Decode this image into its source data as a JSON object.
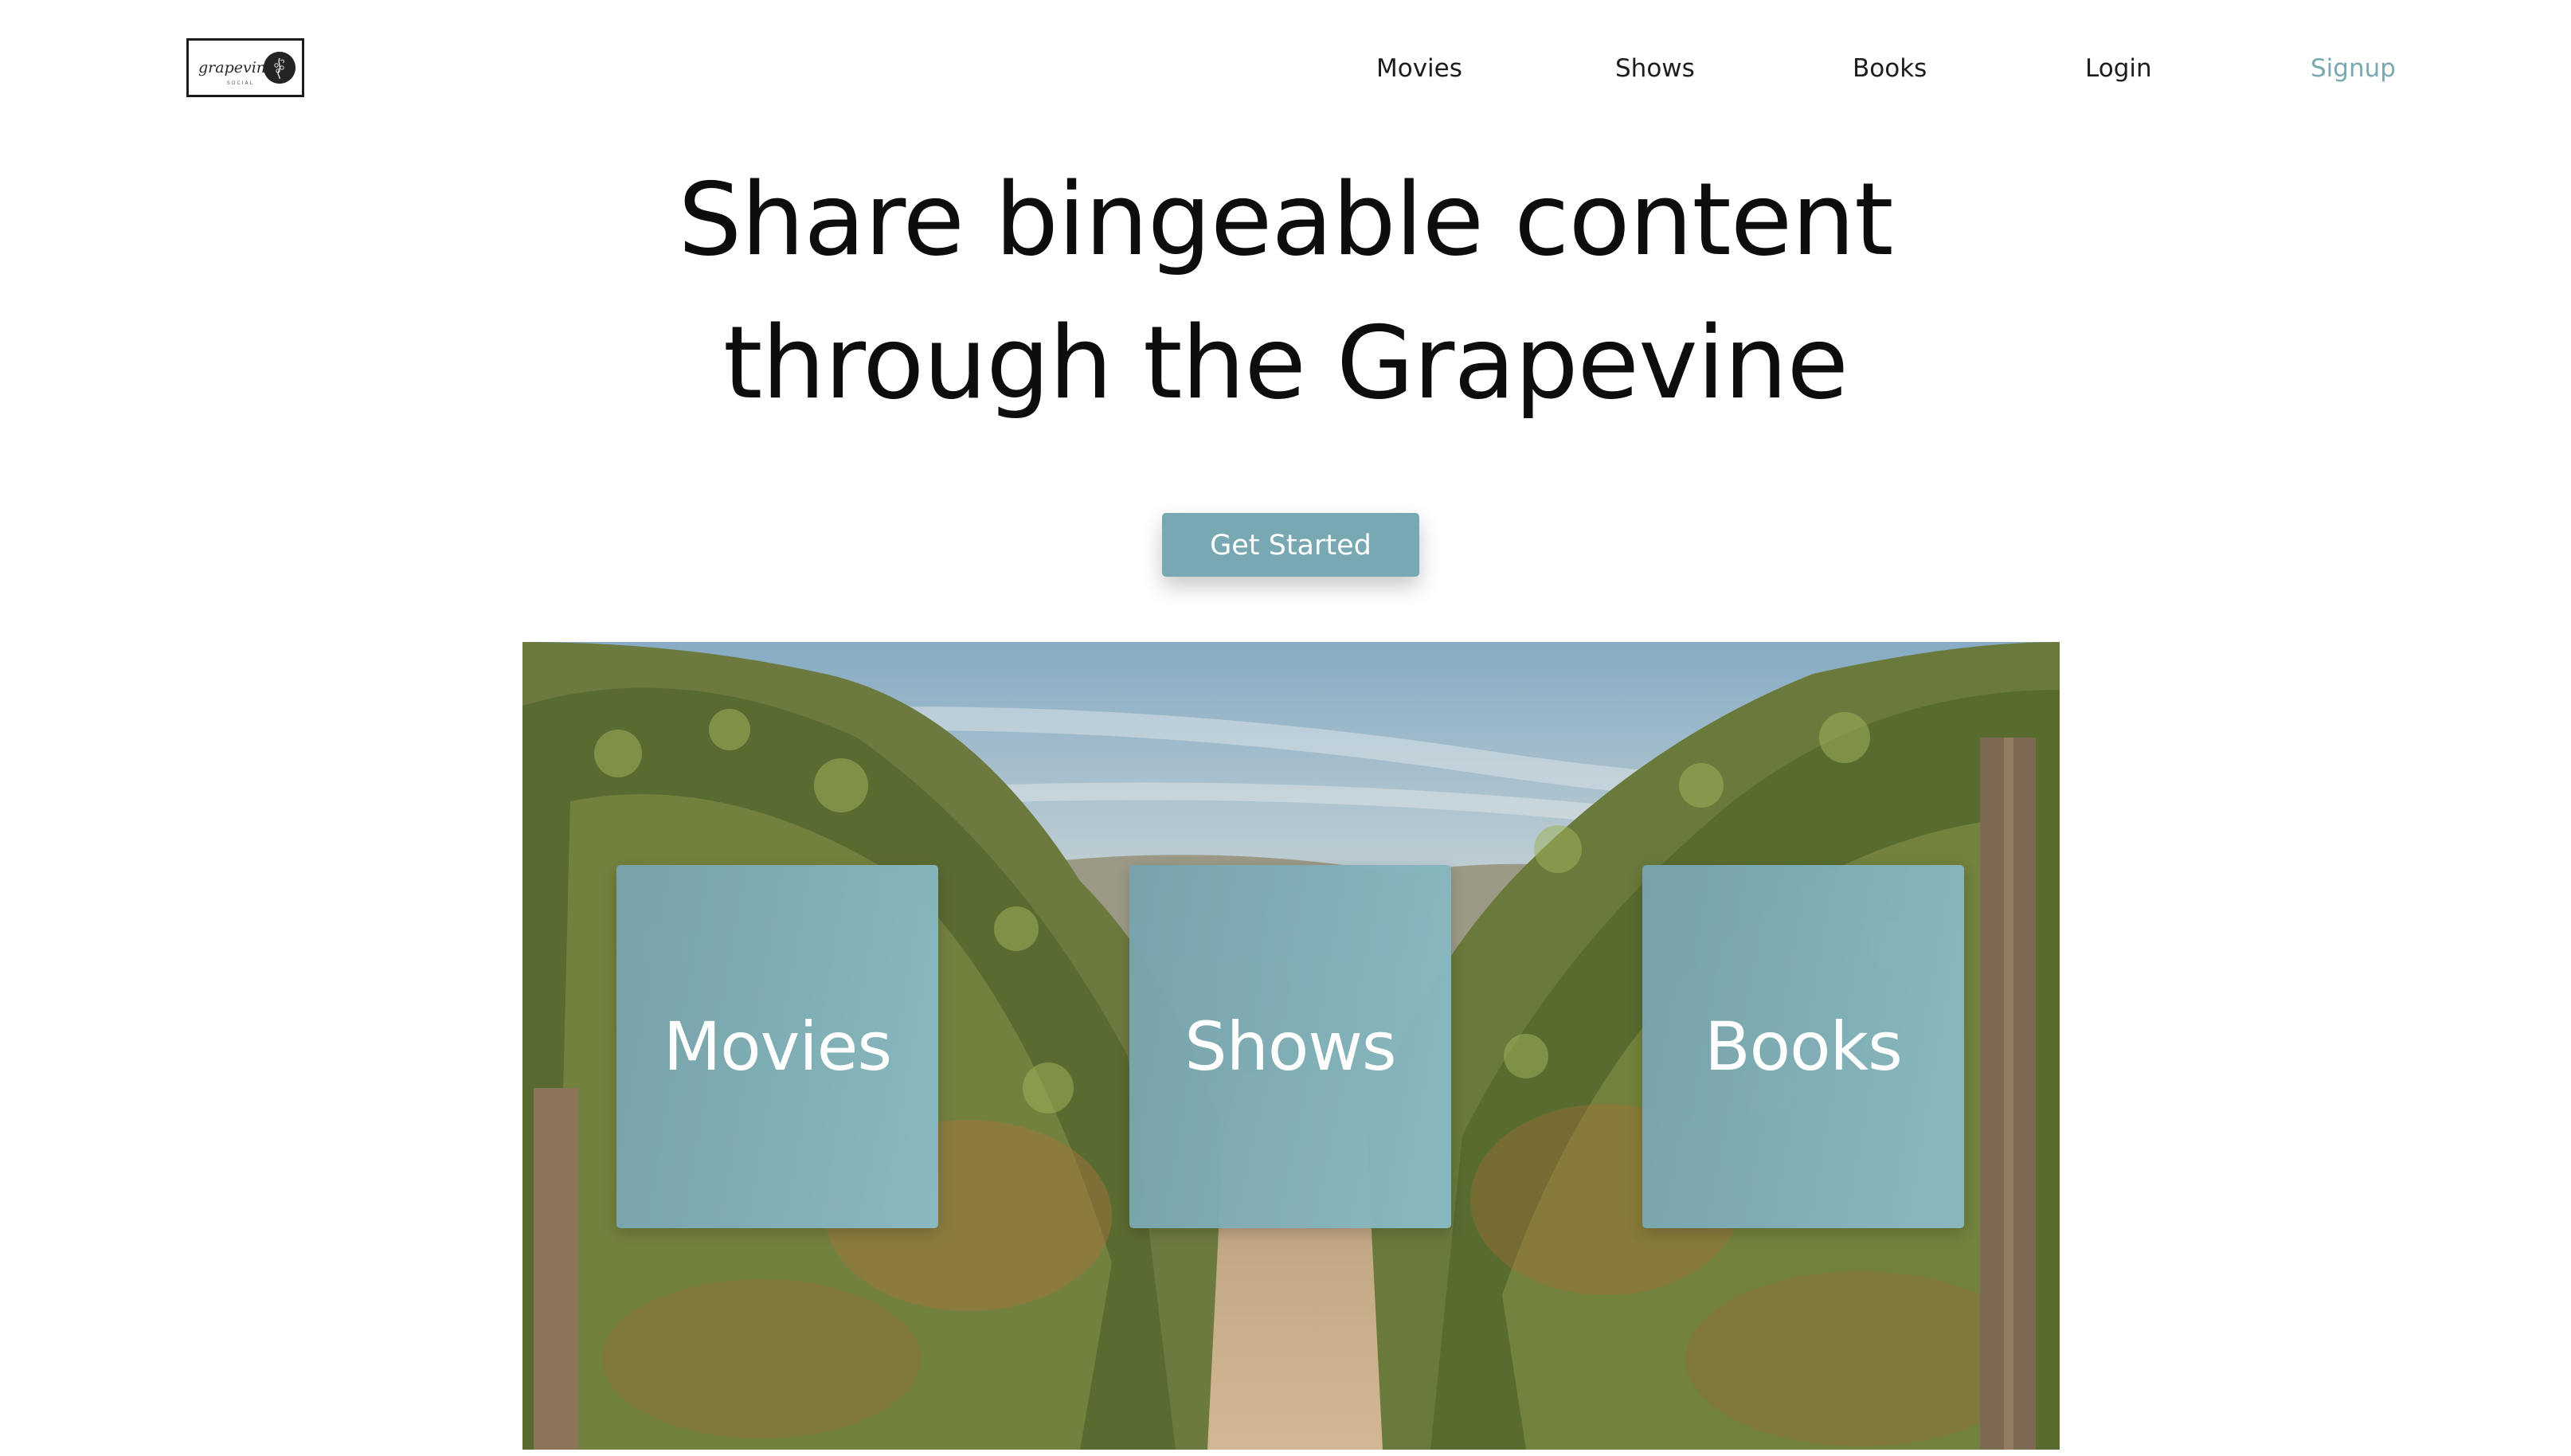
{
  "header": {
    "logo_text": "grapevine",
    "logo_subtext": "SOCIAL",
    "nav": {
      "movies": "Movies",
      "shows": "Shows",
      "books": "Books",
      "login": "Login",
      "signup": "Signup"
    }
  },
  "hero": {
    "headline_line1": "Share bingeable content",
    "headline_line2": "through the Grapevine",
    "cta_label": "Get Started"
  },
  "categories": {
    "movies": "Movies",
    "shows": "Shows",
    "books": "Books"
  },
  "colors": {
    "accent": "#78a8b2",
    "signup_link": "#7aa8b1",
    "text": "#0d0d0d"
  },
  "icons": {
    "logo_mark": "grape-vine-emblem-icon"
  }
}
